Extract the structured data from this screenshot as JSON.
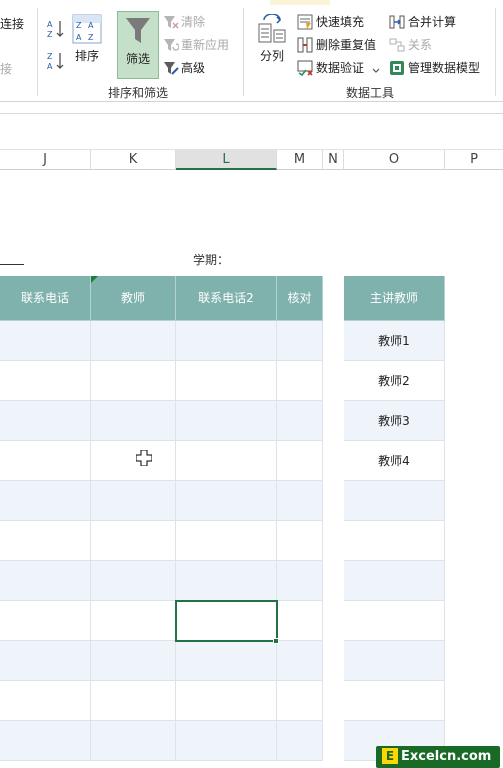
{
  "ribbon": {
    "connect_label": "连接",
    "connect2_label": "接",
    "sort_label": "排序",
    "filter_label": "筛选",
    "clear_label": "清除",
    "reapply_label": "重新应用",
    "advanced_label": "高级",
    "sort_filter_group": "排序和筛选",
    "text_to_columns_label": "分列",
    "flash_fill_label": "快速填充",
    "remove_duplicates_label": "删除重复值",
    "data_validation_label": "数据验证",
    "consolidate_label": "合并计算",
    "relationships_label": "关系",
    "manage_data_model_label": "管理数据模型",
    "data_tools_group": "数据工具"
  },
  "columns": [
    "J",
    "K",
    "L",
    "M",
    "N",
    "O",
    "P"
  ],
  "selected_column": "L",
  "sheet": {
    "semester_label": "学期：",
    "table_headers": [
      "联系电话",
      "教师",
      "联系电话2",
      "核对"
    ],
    "side_header": "主讲教师",
    "teachers": [
      "教师1",
      "教师2",
      "教师3",
      "教师4"
    ]
  },
  "watermark": {
    "logo_letter": "E",
    "text": "Excelcn.com"
  },
  "colors": {
    "header_fill": "#7fb2ad",
    "band_fill": "#eef4fa",
    "selection": "#217346",
    "filter_active": "#c5e0c8"
  }
}
